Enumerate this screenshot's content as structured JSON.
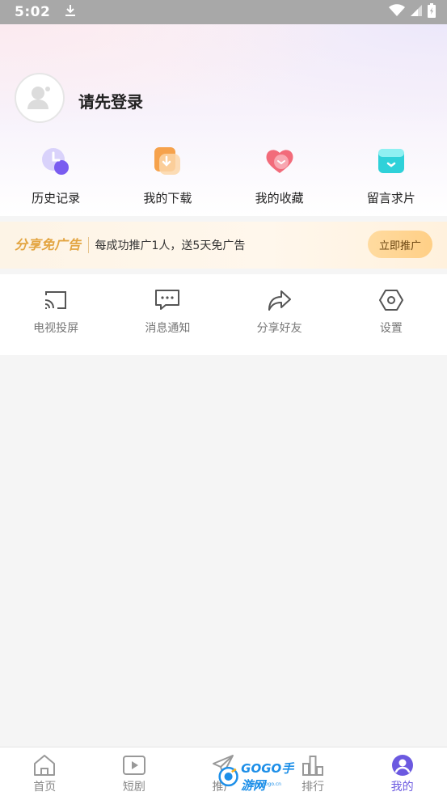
{
  "status_bar": {
    "time": "5:02"
  },
  "profile": {
    "login_prompt": "请先登录"
  },
  "quick_actions": [
    {
      "label": "历史记录",
      "icon": "history-clock-icon"
    },
    {
      "label": "我的下载",
      "icon": "download-icon"
    },
    {
      "label": "我的收藏",
      "icon": "favorite-heart-icon"
    },
    {
      "label": "留言求片",
      "icon": "message-box-icon"
    }
  ],
  "promo": {
    "title": "分享免广告",
    "description": "每成功推广1人，送5天免广告",
    "button": "立即推广"
  },
  "tools": [
    {
      "label": "电视投屏",
      "icon": "cast-icon"
    },
    {
      "label": "消息通知",
      "icon": "message-icon"
    },
    {
      "label": "分享好友",
      "icon": "share-icon"
    },
    {
      "label": "设置",
      "icon": "settings-icon"
    }
  ],
  "bottom_nav": [
    {
      "label": "首页",
      "icon": "home-icon"
    },
    {
      "label": "短剧",
      "icon": "play-icon"
    },
    {
      "label": "推广",
      "icon": "send-icon"
    },
    {
      "label": "排行",
      "icon": "rank-icon"
    },
    {
      "label": "我的",
      "icon": "user-icon",
      "active": true
    }
  ],
  "watermark": {
    "text": "GOGO手游网",
    "subtext": "www.gogo.cn"
  },
  "colors": {
    "accent": "#6b59e0",
    "promo": "#e3a542"
  }
}
